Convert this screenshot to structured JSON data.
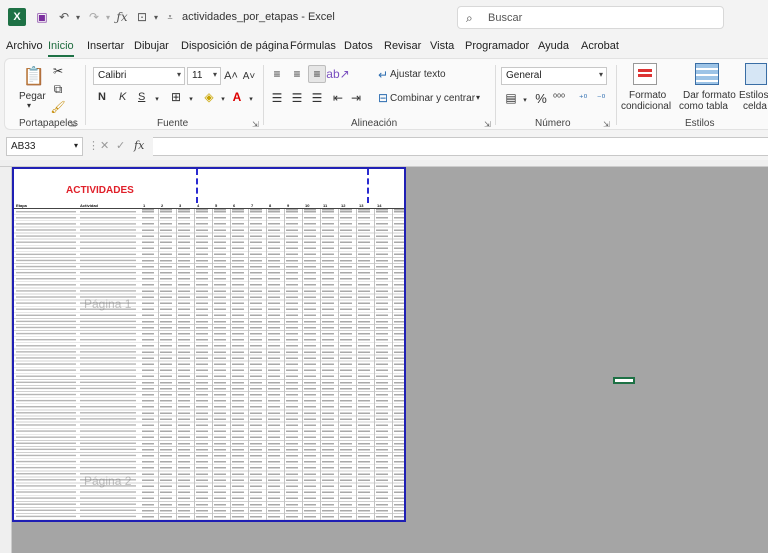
{
  "window": {
    "doc_title": "actividades_por_etapas  -  Excel",
    "search_placeholder": "Buscar"
  },
  "menu": {
    "tabs": [
      "Archivo",
      "Inicio",
      "Insertar",
      "Dibujar",
      "Disposición de página",
      "Fórmulas",
      "Datos",
      "Revisar",
      "Vista",
      "Programador",
      "Ayuda",
      "Acrobat"
    ],
    "active": "Inicio"
  },
  "ribbon": {
    "clipboard": {
      "paste_label": "Pegar",
      "group_label": "Portapapeles"
    },
    "font": {
      "family": "Calibri",
      "size": "11",
      "group_label": "Fuente",
      "bold": "N",
      "italic": "K",
      "underline": "S"
    },
    "alignment": {
      "wrap_label": "Ajustar texto",
      "merge_label": "Combinar y centrar",
      "group_label": "Alineación"
    },
    "number": {
      "format": "General",
      "group_label": "Número"
    },
    "styles": {
      "conditional_line1": "Formato",
      "conditional_line2": "condicional",
      "table_line1": "Dar formato",
      "table_line2": "como tabla",
      "cell_line1": "Estilos de",
      "cell_line2": "celda",
      "group_label": "Estilos"
    }
  },
  "formula_bar": {
    "name_box": "AB33",
    "fx": "fx",
    "value": ""
  },
  "sheet": {
    "title": "ACTIVIDADES",
    "header_etapa": "Etapa",
    "header_actividad": "Actividad",
    "header_cols": [
      "1",
      "2",
      "3",
      "4",
      "5",
      "6",
      "7",
      "8",
      "9",
      "10",
      "11",
      "12",
      "13",
      "14"
    ],
    "watermark_1": "Página 1",
    "watermark_2": "Página 2"
  }
}
